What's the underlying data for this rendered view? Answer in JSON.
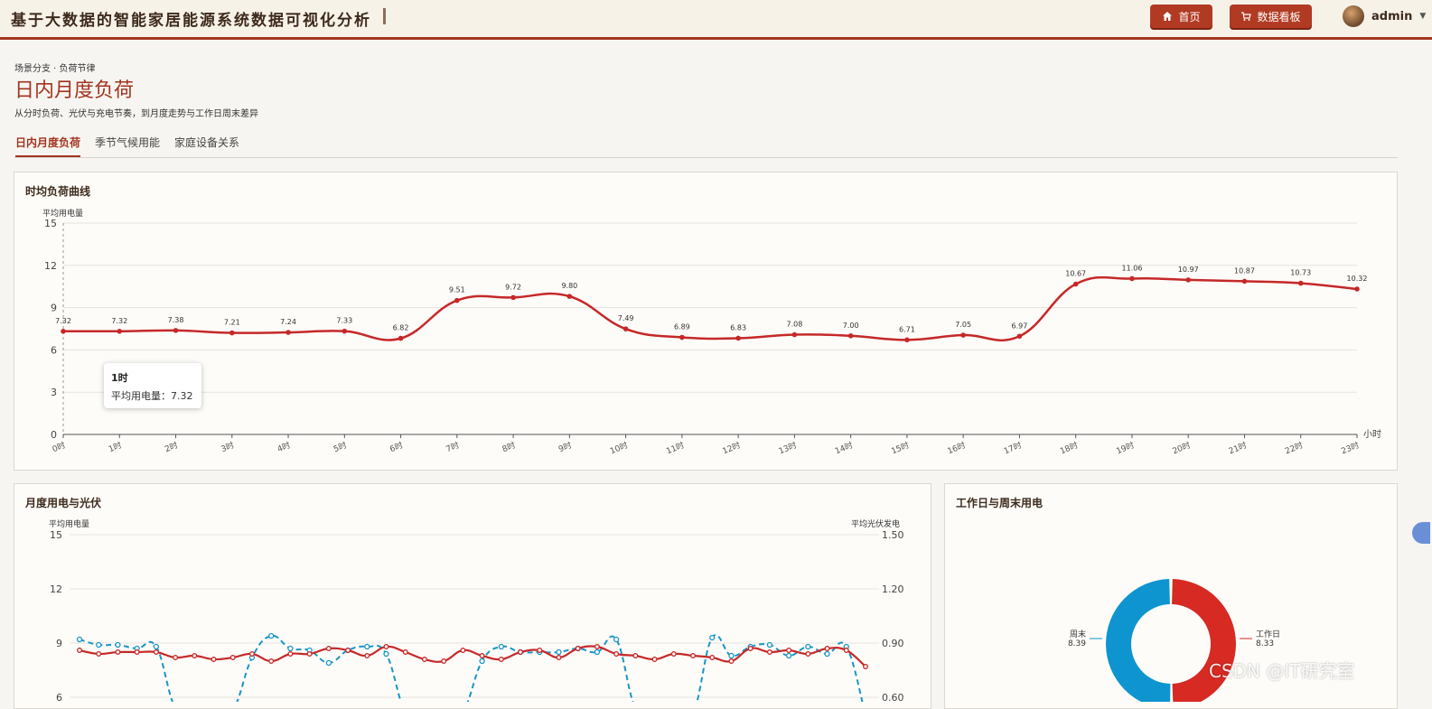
{
  "header": {
    "app_title": "基于大数据的智能家居能源系统数据可视化分析",
    "nav": {
      "home_label": "首页",
      "dashboard_label": "数据看板"
    },
    "user": {
      "name": "admin"
    }
  },
  "page": {
    "breadcrumb": "场景分支 · 负荷节律",
    "title": "日内月度负荷",
    "subtitle": "从分时负荷、光伏与充电节奏，到月度走势与工作日周末差异",
    "tabs": [
      {
        "label": "日内月度负荷",
        "active": true
      },
      {
        "label": "季节气候用能",
        "active": false
      },
      {
        "label": "家庭设备关系",
        "active": false
      }
    ]
  },
  "hourly_card": {
    "title": "时均负荷曲线",
    "tooltip": {
      "title": "1时",
      "label": "平均用电量：",
      "value": "7.32"
    }
  },
  "monthly_card": {
    "title": "月度用电与光伏"
  },
  "weekday_card": {
    "title": "工作日与周末用电"
  },
  "watermark": "CSDN @IT研究室",
  "colors": {
    "accent": "#a3341f",
    "load_line": "#c62828",
    "pv_line": "#1a95c6",
    "weekday": "#d62a22",
    "weekend": "#0e95d0"
  },
  "chart_data": [
    {
      "type": "line",
      "ylabel": "平均用电量",
      "xlabel": "小时",
      "ylim": [
        0,
        15
      ],
      "yticks": [
        0,
        3,
        6,
        9,
        12,
        15
      ],
      "categories": [
        "0时",
        "1时",
        "2时",
        "3时",
        "4时",
        "5时",
        "6时",
        "7时",
        "8时",
        "9时",
        "10时",
        "11时",
        "12时",
        "13时",
        "14时",
        "15时",
        "16时",
        "17时",
        "18时",
        "19时",
        "20时",
        "21时",
        "22时",
        "23时"
      ],
      "series": [
        {
          "values": [
            7.32,
            7.32,
            7.38,
            7.21,
            7.24,
            7.33,
            6.82,
            9.51,
            9.72,
            9.8,
            7.49,
            6.89,
            6.83,
            7.08,
            7.0,
            6.71,
            7.05,
            6.97,
            10.67,
            11.06,
            10.97,
            10.87,
            10.73,
            10.32
          ]
        }
      ],
      "grid": true
    },
    {
      "type": "line",
      "ylabel": "平均用电量",
      "y2label": "平均光伏发电",
      "ylim": [
        6,
        15
      ],
      "y2lim": [
        0.6,
        1.5
      ],
      "yticks": [
        6,
        9,
        12,
        15
      ],
      "y2ticks": [
        "0.60",
        "0.90",
        "1.20",
        "1.50"
      ],
      "series": [
        {
          "axis": "left",
          "style": "solid",
          "values": [
            8.6,
            8.4,
            8.5,
            8.5,
            8.5,
            8.2,
            8.3,
            8.1,
            8.2,
            8.4,
            8.0,
            8.4,
            8.4,
            8.7,
            8.6,
            8.3,
            8.8,
            8.5,
            8.1,
            8.0,
            8.6,
            8.3,
            8.1,
            8.5,
            8.6,
            8.2,
            8.7,
            8.8,
            8.4,
            8.3,
            8.1,
            8.4,
            8.3,
            8.2,
            8.0,
            8.7,
            8.5,
            8.6,
            8.4,
            8.7,
            8.6,
            7.7
          ]
        },
        {
          "axis": "right",
          "style": "dashed",
          "values": [
            0.92,
            0.89,
            0.89,
            0.87,
            0.88,
            0.54,
            0.53,
            0.53,
            0.53,
            0.82,
            0.94,
            0.87,
            0.86,
            0.79,
            0.86,
            0.88,
            0.84,
            0.52,
            0.52,
            0.51,
            0.52,
            0.8,
            0.88,
            0.85,
            0.85,
            0.85,
            0.87,
            0.85,
            0.92,
            0.54,
            0.52,
            0.54,
            0.51,
            0.93,
            0.83,
            0.88,
            0.89,
            0.83,
            0.88,
            0.84,
            0.88,
            0.5
          ]
        }
      ],
      "grid": true
    },
    {
      "type": "pie",
      "donut": true,
      "slices": [
        {
          "label": "工作日",
          "value": 8.33
        },
        {
          "label": "周末",
          "value": 8.39
        }
      ]
    }
  ]
}
